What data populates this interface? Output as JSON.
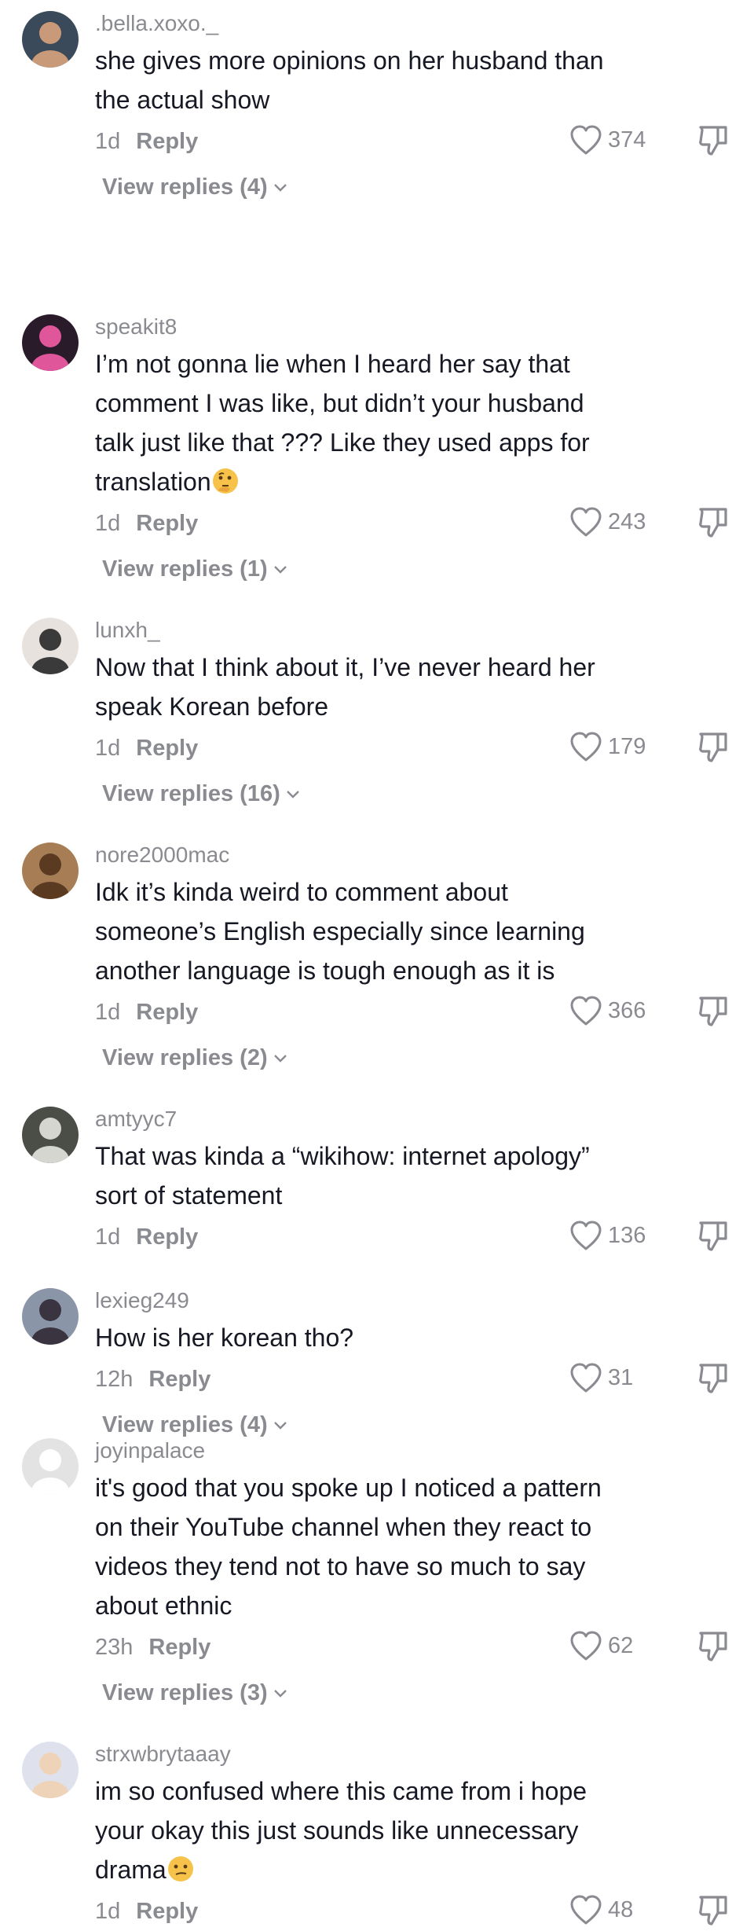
{
  "comments": [
    {
      "username": ".bella.xoxo._",
      "lines": [
        "she gives more opinions on her husband than",
        "the actual show"
      ],
      "emoji": "",
      "time": "1d",
      "reply_label": "Reply",
      "likes": "374",
      "view_replies": "View replies (4)",
      "avatar": {
        "bg": "#3b4a5a",
        "fg": "#c99a7a"
      }
    },
    {
      "username": "speakit8",
      "lines": [
        "I’m not gonna lie when I heard her say that",
        "comment I was like, but didn’t your husband",
        "talk just like that ??? Like they used apps for",
        "translation"
      ],
      "emoji": "thinking-face",
      "time": "1d",
      "reply_label": "Reply",
      "likes": "243",
      "view_replies": "View replies (1)",
      "avatar": {
        "bg": "#2a1b2b",
        "fg": "#e0569a"
      }
    },
    {
      "username": "lunxh_",
      "lines": [
        "Now that I think about it, I’ve never heard her",
        "speak Korean before"
      ],
      "emoji": "",
      "time": "1d",
      "reply_label": "Reply",
      "likes": "179",
      "view_replies": "View replies (16)",
      "avatar": {
        "bg": "#e7e2de",
        "fg": "#3a3a3a"
      }
    },
    {
      "username": "nore2000mac",
      "lines": [
        "Idk it’s kinda weird to comment about",
        "someone’s English especially since learning",
        "another language is tough enough as it is"
      ],
      "emoji": "",
      "time": "1d",
      "reply_label": "Reply",
      "likes": "366",
      "view_replies": "View replies (2)",
      "avatar": {
        "bg": "#a77d55",
        "fg": "#5a3b22"
      }
    },
    {
      "username": "amtyyc7",
      "lines": [
        "That was kinda a “wikihow: internet apology”",
        "sort of statement"
      ],
      "emoji": "",
      "time": "1d",
      "reply_label": "Reply",
      "likes": "136",
      "view_replies": "",
      "avatar": {
        "bg": "#4a4e47",
        "fg": "#d6d6d0"
      }
    },
    {
      "username": "lexieg249",
      "lines": [
        "How is her korean tho?"
      ],
      "emoji": "",
      "time": "12h",
      "reply_label": "Reply",
      "likes": "31",
      "view_replies": "View replies (4)",
      "avatar": {
        "bg": "#8a96a8",
        "fg": "#3a3440"
      }
    },
    {
      "username": "joyinpalace",
      "lines": [
        "it's good that you spoke up I noticed a pattern",
        "on their YouTube channel when they react to",
        "videos they tend not to have so much to say",
        "about ethnic"
      ],
      "emoji": "",
      "time": "23h",
      "reply_label": "Reply",
      "likes": "62",
      "view_replies": "View replies (3)",
      "avatar": {
        "bg": "#e3e3e3",
        "fg": "#ffffff"
      }
    },
    {
      "username": "strxwbrytaaay",
      "lines": [
        "im so confused where this came from i hope",
        "your okay this just sounds like unnecessary",
        "drama"
      ],
      "emoji": "confused-face",
      "time": "1d",
      "reply_label": "Reply",
      "likes": "48",
      "view_replies": "",
      "avatar": {
        "bg": "#dfe2ec",
        "fg": "#efd3b8"
      }
    }
  ]
}
